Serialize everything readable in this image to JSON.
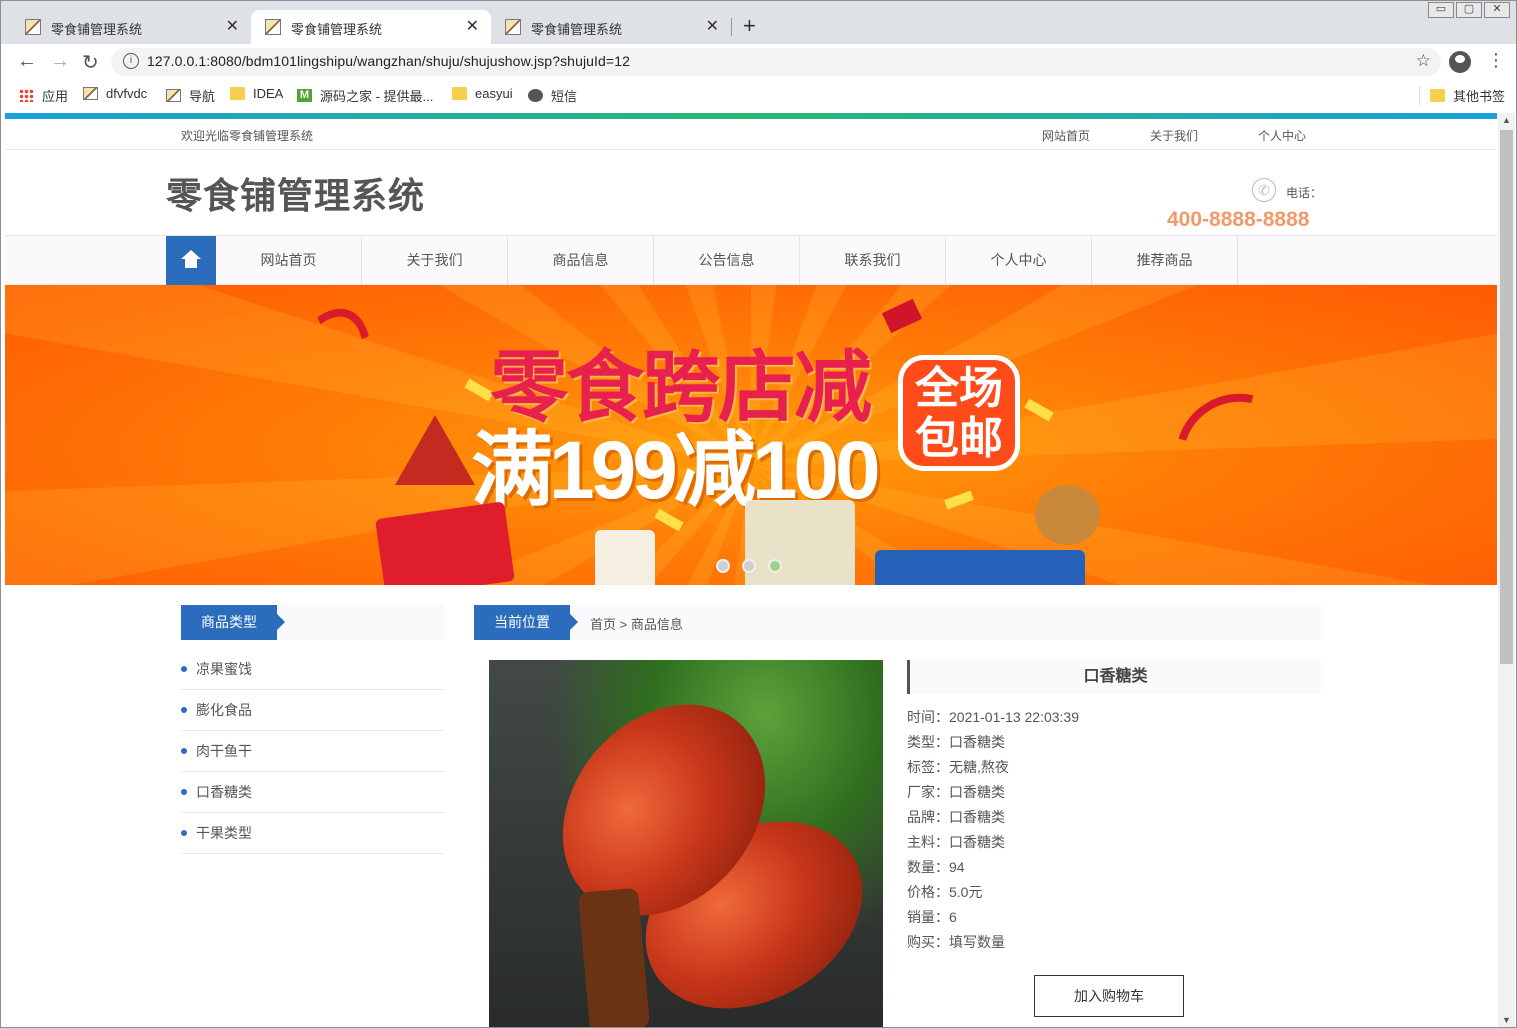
{
  "browser": {
    "tabs": [
      {
        "title": "零食铺管理系统",
        "close": "✕"
      },
      {
        "title": "零食铺管理系统",
        "close": "✕"
      },
      {
        "title": "零食铺管理系统",
        "close": "✕"
      }
    ],
    "new_tab": "+",
    "window_buttons": [
      "▭",
      "▢",
      "✕"
    ],
    "url": "127.0.0.1:8080/bdm101lingshipu/wangzhan/shuju/shujushow.jsp?shujuId=12",
    "icons": {
      "back": "←",
      "forward": "→",
      "reload": "↻",
      "info": "i",
      "star": "☆",
      "menu": "⋮"
    },
    "bookmarks": [
      {
        "label": "应用",
        "icon": "apps-grid-icon"
      },
      {
        "label": "dfvfvdc",
        "icon": "image-favicon"
      },
      {
        "label": "导航",
        "icon": "image-favicon"
      },
      {
        "label": "IDEA",
        "icon": "folder-icon"
      },
      {
        "label": "源码之家 - 提供最...",
        "icon": "m-favicon"
      },
      {
        "label": "easyui",
        "icon": "folder-icon"
      },
      {
        "label": "短信",
        "icon": "globe-icon"
      }
    ],
    "other_bookmarks": "其他书签"
  },
  "site": {
    "welcome": "欢迎光临零食铺管理系统",
    "top_links": [
      "网站首页",
      "关于我们",
      "个人中心"
    ],
    "logo": "零食铺管理系统",
    "phone_label": "电话：",
    "phone_number": "400-8888-8888",
    "nav": [
      "网站首页",
      "关于我们",
      "商品信息",
      "公告信息",
      "联系我们",
      "个人中心",
      "推荐商品"
    ],
    "banner": {
      "line1": "零食跨店减",
      "line2": "满199减100",
      "badge": "全场包邮"
    },
    "sidebar": {
      "title": "商品类型",
      "categories": [
        "凉果蜜饯",
        "膨化食品",
        "肉干鱼干",
        "口香糖类",
        "干果类型"
      ]
    },
    "breadcrumb": {
      "title": "当前位置",
      "path": "首页 > 商品信息"
    },
    "product": {
      "name": "口香糖类",
      "fields": [
        "时间：2021-01-13 22:03:39",
        "类型：口香糖类",
        "标签：无糖,熬夜",
        "厂家：口香糖类",
        "品牌：口香糖类",
        "主料：口香糖类",
        "数量：94",
        "价格：5.0元",
        "销量：6",
        "购买：填写数量"
      ],
      "cart_button": "加入购物车"
    }
  },
  "colors": {
    "accent": "#2b6cbd",
    "phone": "#f29a69",
    "banner": "#ff7a06"
  }
}
